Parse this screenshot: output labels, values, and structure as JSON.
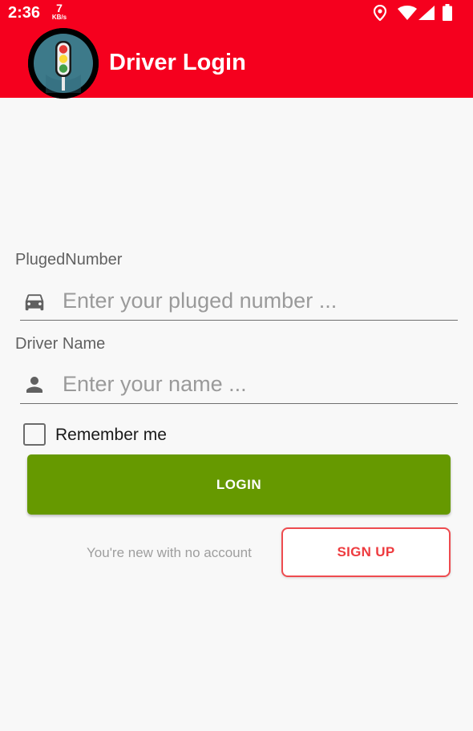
{
  "status_bar": {
    "time": "2:36",
    "net_speed_value": "7",
    "net_speed_unit": "KB/s",
    "icons": [
      "location-icon",
      "wifi-icon",
      "signal-icon",
      "battery-icon"
    ]
  },
  "app_bar": {
    "title": "Driver Login",
    "logo_icon": "traffic-light-icon",
    "background_color": "#f5001e"
  },
  "form": {
    "plug_number": {
      "label": "PlugedNumber",
      "placeholder": "Enter your pluged number ...",
      "value": "",
      "icon": "car-icon"
    },
    "driver_name": {
      "label": "Driver Name",
      "placeholder": "Enter your name ...",
      "value": "",
      "icon": "person-icon"
    },
    "remember_me": {
      "label": "Remember me",
      "checked": false
    },
    "login_button": {
      "label": "LOGIN",
      "color": "#669900"
    },
    "signup": {
      "prompt": "You're new with no account",
      "button_label": "SIGN UP",
      "accent_color": "#ee4b4f"
    }
  }
}
